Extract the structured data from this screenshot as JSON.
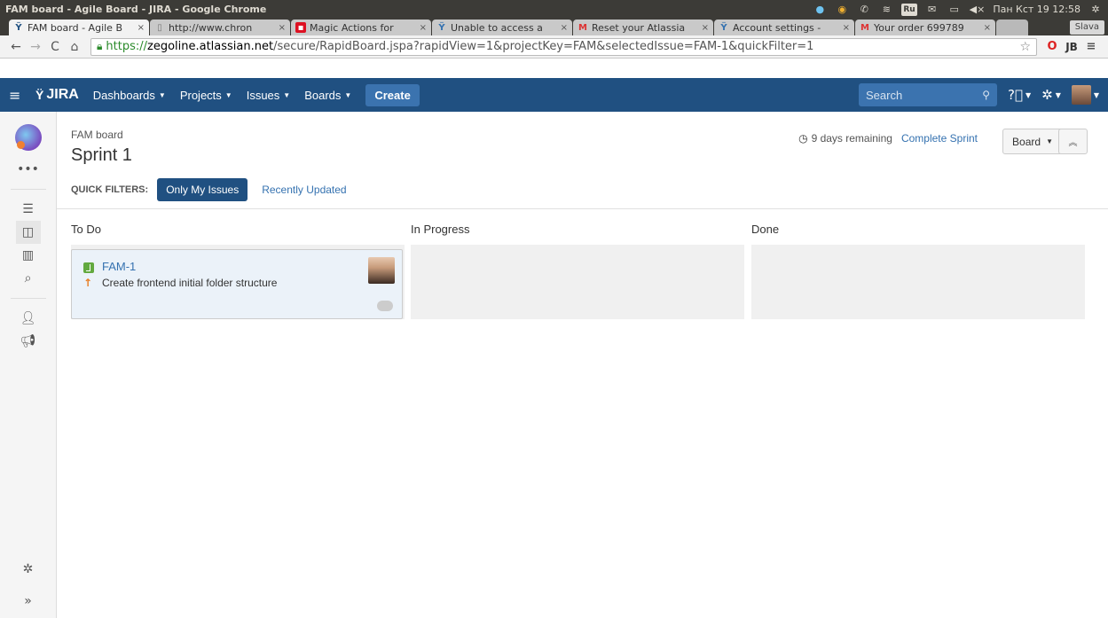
{
  "os": {
    "window_title": "FAM board - Agile Board - JIRA - Google Chrome",
    "keyboard_layout": "Ru",
    "volume": "◀×",
    "clock": "Пан Кст 19 12:58"
  },
  "tabs": [
    {
      "label": "FAM board - Agile B",
      "favicon": "jira-icon",
      "active": true
    },
    {
      "label": "http://www.chron",
      "favicon": "page-icon",
      "active": false
    },
    {
      "label": "Magic Actions for",
      "favicon": "magic-actions-icon",
      "active": false
    },
    {
      "label": "Unable to access a",
      "favicon": "atlassian-icon",
      "active": false
    },
    {
      "label": "Reset your Atlassia",
      "favicon": "gmail-icon",
      "active": false
    },
    {
      "label": "Account settings -",
      "favicon": "atlassian-icon",
      "active": false
    },
    {
      "label": "Your order 699789",
      "favicon": "gmail-icon",
      "active": false
    }
  ],
  "profile_name": "Slava",
  "address": {
    "scheme": "https://",
    "host": "zegoline.atlassian.net",
    "path": "/secure/RapidBoard.jspa?rapidView=1&projectKey=FAM&selectedIssue=FAM-1&quickFilter=1"
  },
  "header": {
    "logo": "JIRA",
    "nav": [
      "Dashboards",
      "Projects",
      "Issues",
      "Boards"
    ],
    "create_label": "Create",
    "search_placeholder": "Search"
  },
  "board": {
    "name": "FAM board",
    "sprint": "Sprint 1",
    "remaining": "9 days remaining",
    "complete_sprint": "Complete Sprint",
    "board_menu": "Board",
    "quick_filters_label": "QUICK FILTERS:",
    "quick_filters": [
      "Only My Issues",
      "Recently Updated"
    ],
    "columns": [
      "To Do",
      "In Progress",
      "Done"
    ]
  },
  "card": {
    "key": "FAM-1",
    "summary": "Create frontend initial folder structure",
    "type_color": "#62a93f",
    "priority_color": "#e87d23"
  },
  "colors": {
    "header": "#205081",
    "link": "#3572b0",
    "card_bg": "#ebf2f9"
  }
}
